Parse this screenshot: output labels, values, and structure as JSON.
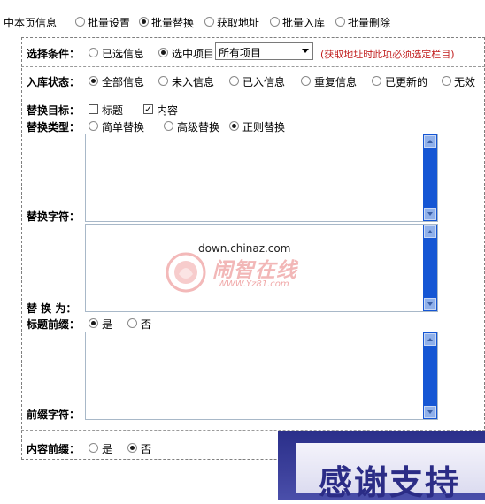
{
  "tabs": [
    {
      "label": "中本页信息",
      "selected": false,
      "has_radio": false
    },
    {
      "label": "批量设置",
      "selected": false,
      "has_radio": true
    },
    {
      "label": "批量替换",
      "selected": true,
      "has_radio": true
    },
    {
      "label": "获取地址",
      "selected": false,
      "has_radio": true
    },
    {
      "label": "批量入库",
      "selected": false,
      "has_radio": true
    },
    {
      "label": "批量删除",
      "selected": false,
      "has_radio": true
    }
  ],
  "condition": {
    "label": "选择条件：",
    "options": [
      {
        "label": "已选信息",
        "selected": false
      },
      {
        "label": "选中项目",
        "selected": true
      }
    ],
    "select_value": "所有项目",
    "note": "(获取地址时此项必须选定栏目)"
  },
  "status": {
    "label": "入库状态：",
    "options": [
      {
        "label": "全部信息",
        "selected": true
      },
      {
        "label": "未入信息",
        "selected": false
      },
      {
        "label": "已入信息",
        "selected": false
      },
      {
        "label": "重复信息",
        "selected": false
      },
      {
        "label": "已更新的",
        "selected": false
      },
      {
        "label": "无效",
        "selected": false
      }
    ]
  },
  "target": {
    "label": "替换目标：",
    "options": [
      {
        "label": "标题",
        "checked": false
      },
      {
        "label": "内容",
        "checked": true
      }
    ]
  },
  "type": {
    "label": "替换类型：",
    "options": [
      {
        "label": "简单替换",
        "selected": false
      },
      {
        "label": "高级替换",
        "selected": false
      },
      {
        "label": "正则替换",
        "selected": true
      }
    ]
  },
  "replace_string": {
    "label": "替换字符："
  },
  "replace_to": {
    "label": "替 换 为："
  },
  "title_prefix": {
    "label": "标题前缀：",
    "options": [
      {
        "label": "是",
        "selected": true
      },
      {
        "label": "否",
        "selected": false
      }
    ]
  },
  "prefix_string": {
    "label": "前缀字符："
  },
  "content_prefix": {
    "label": "内容前缀：",
    "options": [
      {
        "label": "是",
        "selected": false
      },
      {
        "label": "否",
        "selected": true
      }
    ]
  },
  "watermark": {
    "url": "down.chinaz.com",
    "cn": "闹智在线",
    "url2": "WWW.Yz81.com"
  },
  "banner": {
    "text": "感谢支持"
  }
}
